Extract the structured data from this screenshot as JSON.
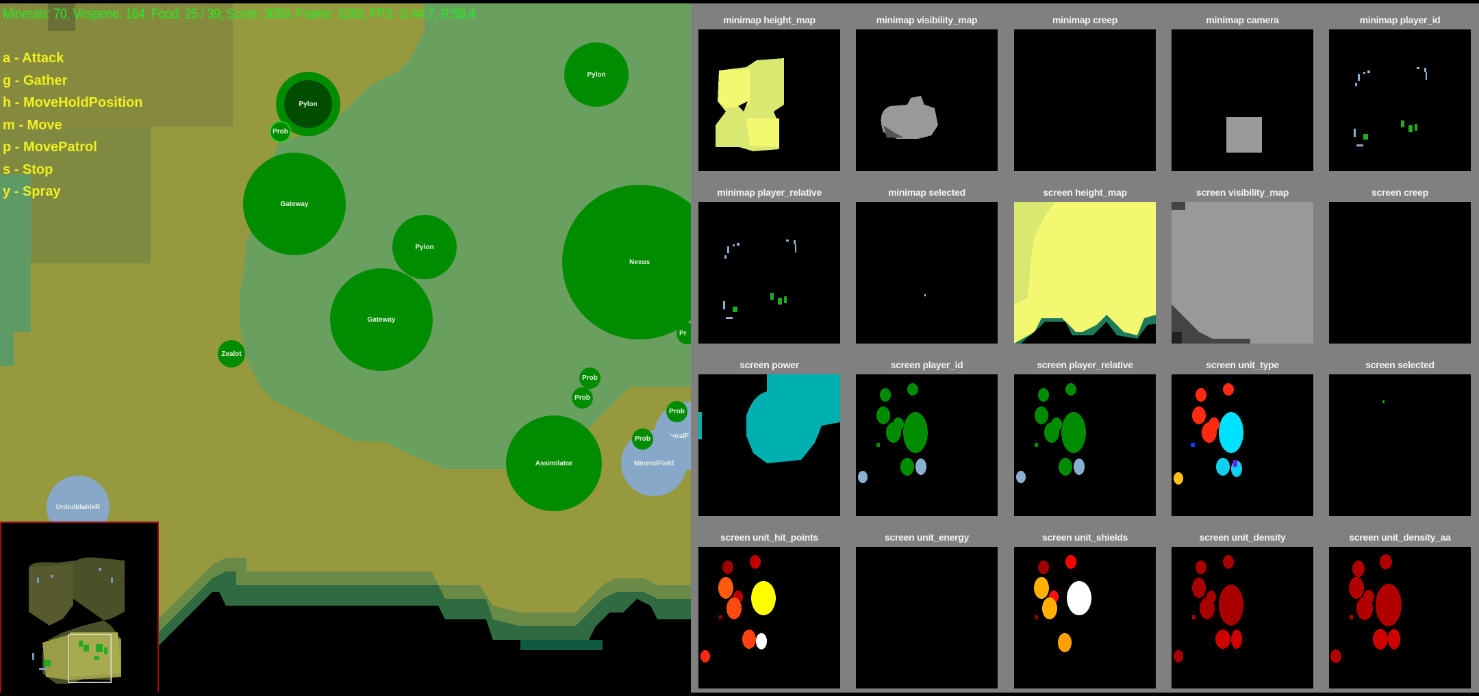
{
  "hud": {
    "status_line": "Minerals: 70, Vespene: 164, Food: 25 / 39; Score: 3059, Frame: 3289, FPS: G:44.7, R:58.4",
    "minerals": 70,
    "vespene": 164,
    "food_used": 25,
    "food_cap": 39,
    "score": 3059,
    "frame": 3289,
    "fps_game": 44.7,
    "fps_render": 58.4
  },
  "hotkeys": [
    {
      "key": "a",
      "action": "Attack",
      "label": "a - Attack"
    },
    {
      "key": "g",
      "action": "Gather",
      "label": "g - Gather"
    },
    {
      "key": "h",
      "action": "MoveHoldPosition",
      "label": "h - MoveHoldPosition"
    },
    {
      "key": "m",
      "action": "Move",
      "label": "m - Move"
    },
    {
      "key": "p",
      "action": "MovePatrol",
      "label": "p - MovePatrol"
    },
    {
      "key": "s",
      "action": "Stop",
      "label": "s - Stop"
    },
    {
      "key": "y",
      "action": "Spray",
      "label": "y - Spray"
    }
  ],
  "units": [
    {
      "name": "Pylon",
      "label": "Pylon",
      "owner": "self",
      "selected_dark": true
    },
    {
      "name": "Probe",
      "label": "Prob",
      "owner": "self",
      "selected": true
    },
    {
      "name": "Pylon",
      "label": "Pylon",
      "owner": "self"
    },
    {
      "name": "Gateway",
      "label": "Gateway",
      "owner": "self"
    },
    {
      "name": "Pylon",
      "label": "Pylon",
      "owner": "self"
    },
    {
      "name": "Gateway",
      "label": "Gateway",
      "owner": "self"
    },
    {
      "name": "Nexus",
      "label": "Nexus",
      "owner": "self"
    },
    {
      "name": "Zealot",
      "label": "Zealot",
      "owner": "self"
    },
    {
      "name": "Probe",
      "label": "Prob",
      "owner": "self"
    },
    {
      "name": "Probe",
      "label": "Prob",
      "owner": "self"
    },
    {
      "name": "Probe",
      "label": "Prob",
      "owner": "self"
    },
    {
      "name": "Probe",
      "label": "Prob",
      "owner": "self"
    },
    {
      "name": "Probe",
      "label": "Pr",
      "owner": "self"
    },
    {
      "name": "Assimilator",
      "label": "Assimilator",
      "owner": "self"
    },
    {
      "name": "MineralField",
      "label": "MineralField",
      "owner": "neutral"
    },
    {
      "name": "MineralField",
      "label": "MineralF",
      "owner": "neutral"
    },
    {
      "name": "UnbuildableRocks",
      "label": "UnbuildableR",
      "owner": "neutral"
    }
  ],
  "colors": {
    "self": "#008c00",
    "self_selected_inner": "#004d00",
    "neutral": "#87a8c8",
    "hud_text": "#22ee22",
    "hotkey_text": "#f0f020",
    "panel_bg": "#808080",
    "minimap_border": "#a01010"
  },
  "feature_layers": [
    {
      "id": "minimap_height_map",
      "title": "minimap height_map"
    },
    {
      "id": "minimap_visibility_map",
      "title": "minimap visibility_map"
    },
    {
      "id": "minimap_creep",
      "title": "minimap creep"
    },
    {
      "id": "minimap_camera",
      "title": "minimap camera"
    },
    {
      "id": "minimap_player_id",
      "title": "minimap player_id"
    },
    {
      "id": "minimap_player_relative",
      "title": "minimap player_relative"
    },
    {
      "id": "minimap_selected",
      "title": "minimap selected"
    },
    {
      "id": "screen_height_map",
      "title": "screen height_map"
    },
    {
      "id": "screen_visibility_map",
      "title": "screen visibility_map"
    },
    {
      "id": "screen_creep",
      "title": "screen creep"
    },
    {
      "id": "screen_power",
      "title": "screen power"
    },
    {
      "id": "screen_player_id",
      "title": "screen player_id"
    },
    {
      "id": "screen_player_relative",
      "title": "screen player_relative"
    },
    {
      "id": "screen_unit_type",
      "title": "screen unit_type"
    },
    {
      "id": "screen_selected",
      "title": "screen selected"
    },
    {
      "id": "screen_unit_hit_points",
      "title": "screen unit_hit_points"
    },
    {
      "id": "screen_unit_energy",
      "title": "screen unit_energy"
    },
    {
      "id": "screen_unit_shields",
      "title": "screen unit_shields"
    },
    {
      "id": "screen_unit_density",
      "title": "screen unit_density"
    },
    {
      "id": "screen_unit_density_aa",
      "title": "screen unit_density_aa"
    }
  ]
}
